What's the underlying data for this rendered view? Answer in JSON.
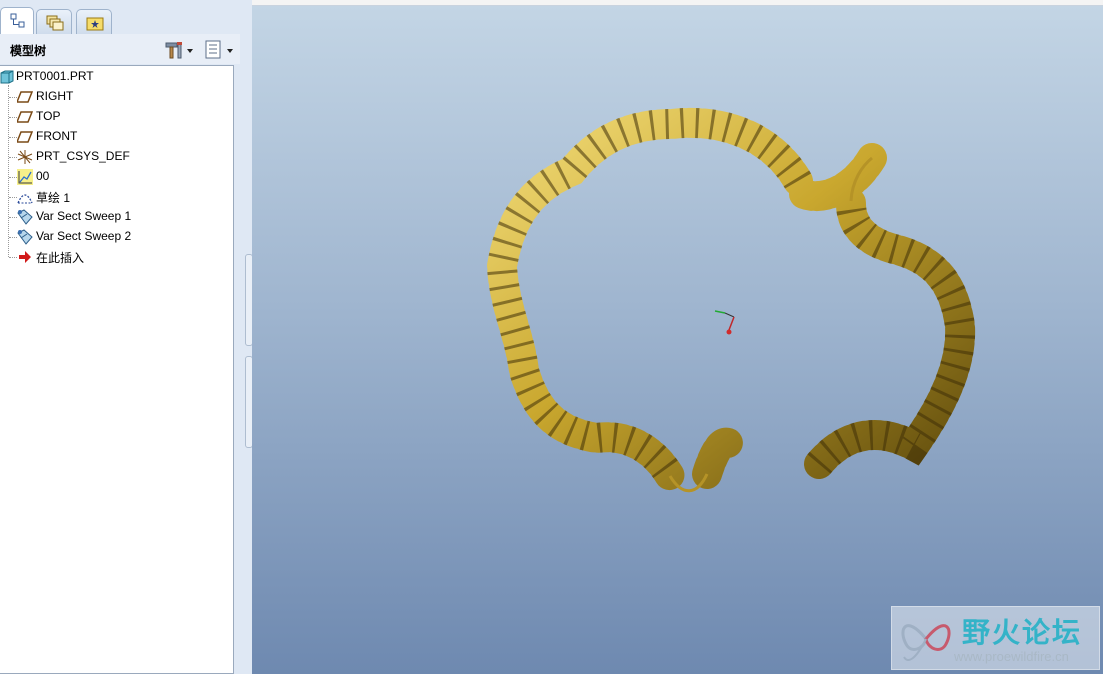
{
  "tabs": [
    {
      "name": "model-tree-tab",
      "icon": "tree-icon",
      "active": true
    },
    {
      "name": "layers-tab",
      "icon": "layers-icon",
      "active": false
    },
    {
      "name": "favorites-tab",
      "icon": "star-folder-icon",
      "active": false
    }
  ],
  "tree": {
    "title": "模型树",
    "settings_icon": "settings-hammer-icon",
    "show_icon": "show-list-icon",
    "root": {
      "label": "PRT0001.PRT",
      "icon": "part-icon"
    },
    "items": [
      {
        "label": "RIGHT",
        "icon": "datum-plane-icon"
      },
      {
        "label": "TOP",
        "icon": "datum-plane-icon"
      },
      {
        "label": "FRONT",
        "icon": "datum-plane-icon"
      },
      {
        "label": "PRT_CSYS_DEF",
        "icon": "coordinate-system-icon"
      },
      {
        "label": "00",
        "icon": "datum-graph-icon"
      },
      {
        "label": "草绘 1",
        "icon": "sketch-icon"
      },
      {
        "label": "Var Sect Sweep 1",
        "icon": "sweep-feature-icon"
      },
      {
        "label": "Var Sect Sweep 2",
        "icon": "sweep-feature-icon"
      },
      {
        "label": "在此插入",
        "icon": "insert-here-arrow-icon"
      }
    ]
  },
  "viewport": {
    "model_color": "#c9a72e",
    "background_top": "#c3d5e5",
    "background_bottom": "#6e89b0"
  },
  "watermark": {
    "title": "野火论坛",
    "url": "www.proewildfire.cn"
  }
}
